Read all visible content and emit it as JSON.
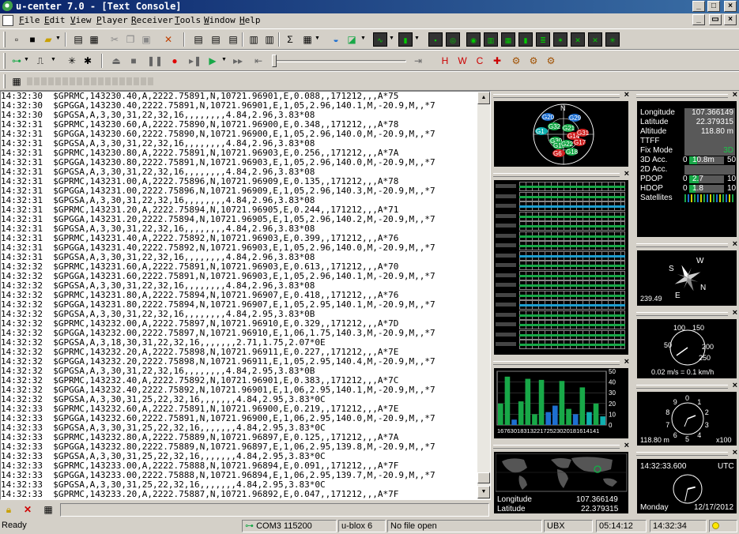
{
  "window": {
    "title": "u-center 7.0 - [Text Console]",
    "min": "_",
    "max": "□",
    "close": "×",
    "restore": "▭"
  },
  "menu": [
    "File",
    "Edit",
    "View",
    "Player",
    "Receiver",
    "Tools",
    "Window",
    "Help"
  ],
  "console": {
    "lines": [
      "14:32:30  $GPRMC,143230.40,A,2222.75891,N,10721.96901,E,0.088,,171212,,,A*75",
      "14:32:30  $GPGGA,143230.40,2222.75891,N,10721.96901,E,1,05,2.96,140.1,M,-20.9,M,,*7",
      "14:32:30  $GPGSA,A,3,30,31,22,32,16,,,,,,,,4.84,2.96,3.83*08",
      "14:32:31  $GPRMC,143230.60,A,2222.75890,N,10721.96900,E,0.348,,171212,,,A*78",
      "14:32:31  $GPGGA,143230.60,2222.75890,N,10721.96900,E,1,05,2.96,140.0,M,-20.9,M,,*7",
      "14:32:31  $GPGSA,A,3,30,31,22,32,16,,,,,,,,4.84,2.96,3.83*08",
      "14:32:31  $GPRMC,143230.80,A,2222.75891,N,10721.96903,E,0.256,,171212,,,A*7A",
      "14:32:31  $GPGGA,143230.80,2222.75891,N,10721.96903,E,1,05,2.96,140.0,M,-20.9,M,,*7",
      "14:32:31  $GPGSA,A,3,30,31,22,32,16,,,,,,,,4.84,2.96,3.83*08",
      "14:32:31  $GPRMC,143231.00,A,2222.75896,N,10721.96909,E,0.135,,171212,,,A*78",
      "14:32:31  $GPGGA,143231.00,2222.75896,N,10721.96909,E,1,05,2.96,140.3,M,-20.9,M,,*7",
      "14:32:31  $GPGSA,A,3,30,31,22,32,16,,,,,,,,4.84,2.96,3.83*08",
      "14:32:31  $GPRMC,143231.20,A,2222.75894,N,10721.96905,E,0.244,,171212,,,A*71",
      "14:32:31  $GPGGA,143231.20,2222.75894,N,10721.96905,E,1,05,2.96,140.2,M,-20.9,M,,*7",
      "14:32:31  $GPGSA,A,3,30,31,22,32,16,,,,,,,,4.84,2.96,3.83*08",
      "14:32:31  $GPRMC,143231.40,A,2222.75892,N,10721.96903,E,0.399,,171212,,,A*76",
      "14:32:31  $GPGGA,143231.40,2222.75892,N,10721.96903,E,1,05,2.96,140.0,M,-20.9,M,,*7",
      "14:32:31  $GPGSA,A,3,30,31,22,32,16,,,,,,,,4.84,2.96,3.83*08",
      "14:32:32  $GPRMC,143231.60,A,2222.75891,N,10721.96903,E,0.613,,171212,,,A*70",
      "14:32:32  $GPGGA,143231.60,2222.75891,N,10721.96903,E,1,05,2.96,140.1,M,-20.9,M,,*7",
      "14:32:32  $GPGSA,A,3,30,31,22,32,16,,,,,,,,4.84,2.96,3.83*08",
      "14:32:32  $GPRMC,143231.80,A,2222.75894,N,10721.96907,E,0.418,,171212,,,A*76",
      "14:32:32  $GPGGA,143231.80,2222.75894,N,10721.96907,E,1,05,2.95,140.1,M,-20.9,M,,*7",
      "14:32:32  $GPGSA,A,3,30,31,22,32,16,,,,,,,,4.84,2.95,3.83*0B",
      "14:32:32  $GPRMC,143232.00,A,2222.75897,N,10721.96910,E,0.329,,171212,,,A*7D",
      "14:32:32  $GPGGA,143232.00,2222.75897,N,10721.96910,E,1,06,1.75,140.3,M,-20.9,M,,*7",
      "14:32:32  $GPGSA,A,3,18,30,31,22,32,16,,,,,,,2.71,1.75,2.07*0E",
      "14:32:32  $GPRMC,143232.20,A,2222.75898,N,10721.96911,E,0.227,,171212,,,A*7E",
      "14:32:32  $GPGGA,143232.20,2222.75898,N,10721.96911,E,1,05,2.95,140.4,M,-20.9,M,,*7",
      "14:32:32  $GPGSA,A,3,30,31,22,32,16,,,,,,,,4.84,2.95,3.83*0B",
      "14:32:32  $GPRMC,143232.40,A,2222.75892,N,10721.96901,E,0.383,,171212,,,A*7C",
      "14:32:32  $GPGGA,143232.40,2222.75892,N,10721.96901,E,1,06,2.95,140.1,M,-20.9,M,,*7",
      "14:32:32  $GPGSA,A,3,30,31,25,22,32,16,,,,,,,4.84,2.95,3.83*0C",
      "14:32:33  $GPRMC,143232.60,A,2222.75891,N,10721.96900,E,0.219,,171212,,,A*7E",
      "14:32:33  $GPGGA,143232.60,2222.75891,N,10721.96900,E,1,06,2.95,140.0,M,-20.9,M,,*7",
      "14:32:33  $GPGSA,A,3,30,31,25,22,32,16,,,,,,,4.84,2.95,3.83*0C",
      "14:32:33  $GPRMC,143232.80,A,2222.75889,N,10721.96897,E,0.125,,171212,,,A*7A",
      "14:32:33  $GPGGA,143232.80,2222.75889,N,10721.96897,E,1,06,2.95,139.8,M,-20.9,M,,*7",
      "14:32:33  $GPGSA,A,3,30,31,25,22,32,16,,,,,,,4.84,2.95,3.83*0C",
      "14:32:33  $GPRMC,143233.00,A,2222.75888,N,10721.96894,E,0.091,,171212,,,A*7F",
      "14:32:33  $GPGGA,143233.00,2222.75888,N,10721.96894,E,1,06,2.95,139.7,M,-20.9,M,,*7",
      "14:32:33  $GPGSA,A,3,30,31,25,22,32,16,,,,,,,4.84,2.95,3.83*0C",
      "14:32:33  $GPRMC,143233.20,A,2222.75887,N,10721.96892,E,0.047,,171212,,,A*7F"
    ]
  },
  "status": {
    "ready": "Ready",
    "port": "COM3 115200",
    "receiver": "u-blox 6",
    "file": "No file open",
    "protocol": "UBX",
    "elapsed": "05:14:12",
    "time": "14:32:34"
  },
  "sky": {
    "north": "N",
    "sats": [
      {
        "id": "G20",
        "color": "#1e6fd0"
      },
      {
        "id": "G29",
        "color": "#1e6fd0"
      },
      {
        "id": "G32",
        "color": "#18a848"
      },
      {
        "id": "G21",
        "color": "#18a848"
      },
      {
        "id": "G1",
        "color": "#10b0b0"
      },
      {
        "id": "G14",
        "color": "#d02020"
      },
      {
        "id": "G31",
        "color": "#d02020"
      },
      {
        "id": "G17",
        "color": "#d02020"
      },
      {
        "id": "G30",
        "color": "#18a848"
      },
      {
        "id": "G16",
        "color": "#18a848"
      },
      {
        "id": "G22",
        "color": "#18a848"
      },
      {
        "id": "G18",
        "color": "#18a848"
      },
      {
        "id": "G6",
        "color": "#d02020"
      }
    ]
  },
  "data_view": {
    "rows": [
      {
        "label": "Longitude",
        "value": "107.366149"
      },
      {
        "label": "Latitude",
        "value": "22.379315"
      },
      {
        "label": "Altitude",
        "value": "118.80 m"
      },
      {
        "label": "TTFF",
        "value": ""
      },
      {
        "label": "Fix Mode",
        "value": "3D"
      },
      {
        "label": "3D Acc.",
        "min": "0",
        "value": "10.8m",
        "max": "50",
        "level": 0.22
      },
      {
        "label": "2D Acc.",
        "value": ""
      },
      {
        "label": "PDOP",
        "min": "0",
        "value": "2.7",
        "max": "10",
        "level": 0.27
      },
      {
        "label": "HDOP",
        "min": "0",
        "value": "1.8",
        "max": "10",
        "level": 0.18
      },
      {
        "label": "Satellites",
        "value": ""
      }
    ]
  },
  "compass": {
    "heading": "239.49",
    "letters": [
      "N",
      "E",
      "S",
      "W"
    ]
  },
  "speedo": {
    "ticks": [
      "50",
      "100",
      "150",
      "200",
      "250"
    ],
    "reading": "0.02 m/s = 0.1 km/h"
  },
  "altimeter": {
    "digits": [
      "0",
      "1",
      "2",
      "3",
      "4",
      "5",
      "6",
      "7",
      "8",
      "9"
    ],
    "reading": "118.80 m",
    "scale": "x100"
  },
  "signal_chart": {
    "type": "bar",
    "ylim": [
      0,
      50
    ],
    "yticks": [
      "50",
      "40",
      "30",
      "20",
      "10",
      "0"
    ],
    "xtitle": "1676301831322172523020181614141",
    "values": [
      20,
      45,
      5,
      22,
      43,
      10,
      42,
      12,
      18,
      41,
      15,
      10,
      35,
      12,
      20,
      8
    ],
    "colors": [
      "#18a848",
      "#18a848",
      "#1e6fd0",
      "#18a848",
      "#18a848",
      "#18a848",
      "#18a848",
      "#1e6fd0",
      "#1e6fd0",
      "#18a848",
      "#18a848",
      "#1e6fd0",
      "#18a848",
      "#10b0b0",
      "#18a848",
      "#10b0b0"
    ]
  },
  "map_view": {
    "longitude_label": "Longitude",
    "longitude": "107.366149",
    "latitude_label": "Latitude",
    "latitude": "22.379315"
  },
  "clock": {
    "time": "14:32:33.600",
    "zone": "UTC",
    "day": "Monday",
    "date": "12/17/2012",
    "hour": 14,
    "minute": 32
  },
  "palette": {
    "bar_green": "#18a848",
    "bar_blue": "#1e6fd0",
    "bar_cyan": "#10b0b0",
    "bar_red": "#d02020"
  }
}
